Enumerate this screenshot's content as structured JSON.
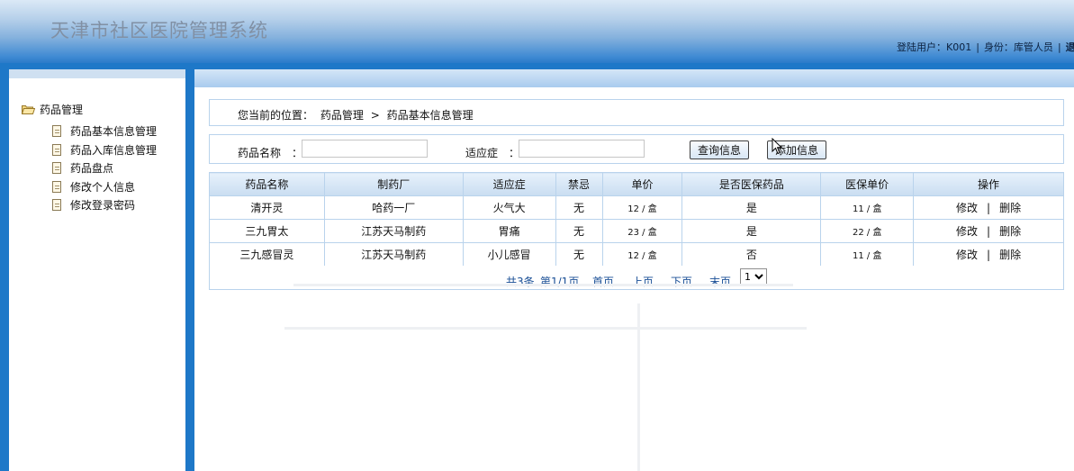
{
  "header": {
    "app_title": "天津市社区医院管理系统",
    "login_label": "登陆用户：",
    "login_user": "K001",
    "role_label": "身份：",
    "role": "库管人员",
    "logout_label": "退出"
  },
  "sidebar": {
    "group_label": "药品管理",
    "group_icon": "folder-open-icon",
    "items": [
      {
        "label": "药品基本信息管理",
        "icon": "document-icon"
      },
      {
        "label": "药品入库信息管理",
        "icon": "document-icon"
      },
      {
        "label": "药品盘点",
        "icon": "document-icon"
      },
      {
        "label": "修改个人信息",
        "icon": "document-icon"
      },
      {
        "label": "修改登录密码",
        "icon": "document-icon"
      }
    ]
  },
  "breadcrumb": {
    "prefix": "您当前的位置：",
    "level1": "药品管理",
    "separator": ">",
    "level2": "药品基本信息管理"
  },
  "search": {
    "name_label": "药品名称　：",
    "name_value": "",
    "indication_label": "适应症　：",
    "indication_value": "",
    "query_button": "查询信息",
    "add_button": "添加信息"
  },
  "table": {
    "headers": [
      "药品名称",
      "制药厂",
      "适应症",
      "禁忌",
      "单价",
      "是否医保药品",
      "医保单价",
      "操作"
    ],
    "rows": [
      {
        "name": "清开灵",
        "maker": "哈药一厂",
        "indication": "火气大",
        "taboo": "无",
        "price": "12 / 盒",
        "insured": "是",
        "insured_price": "11 / 盒"
      },
      {
        "name": "三九胃太",
        "maker": "江苏天马制药",
        "indication": "胃痛",
        "taboo": "无",
        "price": "23 / 盒",
        "insured": "是",
        "insured_price": "22 / 盒"
      },
      {
        "name": "三九感冒灵",
        "maker": "江苏天马制药",
        "indication": "小儿感冒",
        "taboo": "无",
        "price": "12 / 盒",
        "insured": "否",
        "insured_price": "11 / 盒"
      }
    ],
    "edit_label": "修改",
    "op_separator": "|",
    "delete_label": "删除"
  },
  "pager": {
    "total": "共3条",
    "page_info": "第1/1页",
    "first": "首页",
    "prev": "上页",
    "next": "下页",
    "last": "末页",
    "selected_page": "1"
  },
  "colors": {
    "header_blue": "#2a7bc9",
    "border": "#b9d3ec",
    "link": "#1a4f96"
  }
}
